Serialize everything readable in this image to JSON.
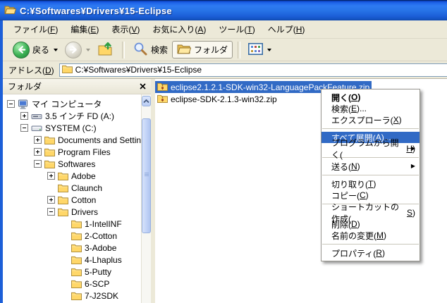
{
  "window": {
    "title": "C:¥Softwares¥Drivers¥15-Eclipse",
    "title_icon": "folder-open-icon"
  },
  "menubar": {
    "items": [
      "ファイル(F)",
      "編集(E)",
      "表示(V)",
      "お気に入り(A)",
      "ツール(T)",
      "ヘルプ(H)"
    ]
  },
  "toolbar": {
    "buttons": [
      {
        "id": "back",
        "icon": "back-icon",
        "label": "戻る",
        "dropdown": true
      },
      {
        "id": "forward",
        "icon": "forward-icon",
        "label": "",
        "dropdown": true,
        "disabled": true
      },
      {
        "id": "up",
        "icon": "up-icon",
        "label": ""
      },
      {
        "sep": true
      },
      {
        "id": "search",
        "icon": "search-icon",
        "label": "検索"
      },
      {
        "id": "folders",
        "icon": "folders-icon",
        "label": "フォルダ",
        "pressed": true
      },
      {
        "sep": true
      },
      {
        "id": "views",
        "icon": "views-icon",
        "label": "",
        "dropdown": true
      }
    ]
  },
  "addressbar": {
    "label": "アドレス(D)",
    "value": "C:¥Softwares¥Drivers¥15-Eclipse",
    "icon": "folder-icon"
  },
  "folders_pane": {
    "header": "フォルダ",
    "close_icon": "close-icon",
    "tree": [
      {
        "label": "マイ コンピュータ",
        "level": 0,
        "expand": "minus",
        "icon": "computer-icon"
      },
      {
        "label": "3.5 インチ FD (A:)",
        "level": 1,
        "expand": "plus",
        "icon": "floppy-icon"
      },
      {
        "label": "SYSTEM (C:)",
        "level": 1,
        "expand": "minus",
        "icon": "drive-icon"
      },
      {
        "label": "Documents and Settings",
        "level": 2,
        "expand": "plus",
        "icon": "folder-icon"
      },
      {
        "label": "Program Files",
        "level": 2,
        "expand": "plus",
        "icon": "folder-icon"
      },
      {
        "label": "Softwares",
        "level": 2,
        "expand": "minus",
        "icon": "folder-icon"
      },
      {
        "label": "Adobe",
        "level": 3,
        "expand": "plus",
        "icon": "folder-icon"
      },
      {
        "label": "Claunch",
        "level": 3,
        "expand": null,
        "icon": "folder-icon"
      },
      {
        "label": "Cotton",
        "level": 3,
        "expand": "plus",
        "icon": "folder-icon"
      },
      {
        "label": "Drivers",
        "level": 3,
        "expand": "minus",
        "icon": "folder-icon"
      },
      {
        "label": "1-IntelINF",
        "level": 4,
        "expand": null,
        "icon": "folder-icon"
      },
      {
        "label": "2-Cotton",
        "level": 4,
        "expand": null,
        "icon": "folder-icon"
      },
      {
        "label": "3-Adobe",
        "level": 4,
        "expand": null,
        "icon": "folder-icon"
      },
      {
        "label": "4-Lhaplus",
        "level": 4,
        "expand": null,
        "icon": "folder-icon"
      },
      {
        "label": "5-Putty",
        "level": 4,
        "expand": null,
        "icon": "folder-icon"
      },
      {
        "label": "6-SCP",
        "level": 4,
        "expand": null,
        "icon": "folder-icon"
      },
      {
        "label": "7-J2SDK",
        "level": 4,
        "expand": null,
        "icon": "folder-icon"
      }
    ]
  },
  "file_list": {
    "files": [
      {
        "name": "eclipse2.1.2.1-SDK-win32-LanguagePackFeature.zip",
        "icon": "zip-icon",
        "selected": true
      },
      {
        "name": "eclipse-SDK-2.1.3-win32.zip",
        "icon": "zip-icon",
        "selected": false
      }
    ]
  },
  "context_menu": {
    "items": [
      {
        "label": "開く(O)",
        "bold": true
      },
      {
        "label": "検索(E)..."
      },
      {
        "label": "エクスプローラ(X)"
      },
      {
        "separator": true
      },
      {
        "label": "すべて展開(A)...",
        "highlighted": true
      },
      {
        "label": "プログラムから開く(H)",
        "submenu": true
      },
      {
        "separator": true
      },
      {
        "label": "送る(N)",
        "submenu": true
      },
      {
        "separator": true
      },
      {
        "label": "切り取り(T)"
      },
      {
        "label": "コピー(C)"
      },
      {
        "separator": true
      },
      {
        "label": "ショートカットの作成(S)"
      },
      {
        "label": "削除(D)"
      },
      {
        "label": "名前の変更(M)"
      },
      {
        "separator": true
      },
      {
        "label": "プロパティ(R)"
      }
    ]
  },
  "colors": {
    "selection": "#316AC5",
    "chrome": "#ECE9D8",
    "titlebar": "#2874E8",
    "menu_highlight": "#316AC5"
  }
}
